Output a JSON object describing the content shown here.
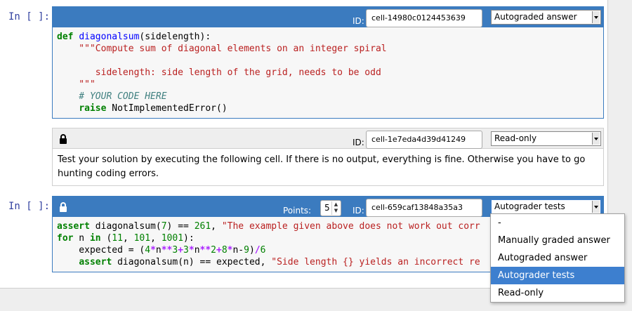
{
  "cells": [
    {
      "prompt": "In [ ]:",
      "id_label": "ID:",
      "cell_id": "cell-14980c0124453639",
      "cell_type": "Autograded answer",
      "code_lines": {
        "l1_def": "def",
        "l1_name": "diagonalsum",
        "l1_rest": "(sidelength):",
        "l2": "    \"\"\"Compute sum of diagonal elements on an integer spiral",
        "l3": "",
        "l4": "       sidelength: side length of the grid, needs to be odd",
        "l5": "    \"\"\"",
        "l6": "    # YOUR CODE HERE",
        "l7_kw": "raise",
        "l7_rest": " NotImplementedError()"
      }
    },
    {
      "id_label": "ID:",
      "cell_id": "cell-1e7eda4d39d41249",
      "cell_type": "Read-only",
      "text_line1": "Test your solution by executing the following cell. If there is no output, everything is fine. Otherwise you have to go",
      "text_line2": "hunting coding errors."
    },
    {
      "prompt": "In [ ]:",
      "points_label": "Points:",
      "points_value": "5",
      "id_label": "ID:",
      "cell_id": "cell-659caf13848a35a3",
      "cell_type": "Autograder tests",
      "code": {
        "a1_kw": "assert",
        "a1_rest1": " diagonalsum(",
        "a1_num": "7",
        "a1_rest2": ") == ",
        "a1_num2": "261",
        "a1_rest3": ", ",
        "a1_str": "\"The example given above does not work out corr",
        "a2_kw": "for",
        "a2_rest1": " n ",
        "a2_kw2": "in",
        "a2_rest2": " (",
        "a2_n1": "11",
        "a2_c1": ", ",
        "a2_n2": "101",
        "a2_c2": ", ",
        "a2_n3": "1001",
        "a2_rest3": "):",
        "a3_pre": "    expected = (",
        "a3_n4": "4",
        "a3_op1": "*",
        "a3_v1": "n",
        "a3_op2": "**",
        "a3_n3": "3",
        "a3_op3": "+",
        "a3_n3b": "3",
        "a3_op4": "*",
        "a3_v2": "n",
        "a3_op5": "**",
        "a3_n2": "2",
        "a3_op6": "+",
        "a3_n8": "8",
        "a3_op7": "*",
        "a3_v3": "n-",
        "a3_n9": "9",
        "a3_close": ")",
        "a3_op8": "/",
        "a3_n6": "6",
        "a4_pre": "    ",
        "a4_kw": "assert",
        "a4_rest": " diagonalsum(n) == expected, ",
        "a4_str": "\"Side length {} yields an incorrect re"
      }
    }
  ],
  "dropdown": {
    "options": [
      "-",
      "Manually graded answer",
      "Autograded answer",
      "Autograder tests",
      "Read-only"
    ],
    "selected": "Autograder tests"
  },
  "colors": {
    "toolbar_active": "#3b7bbf",
    "prompt": "#303f9f",
    "selected_option": "#3d7fcf"
  }
}
